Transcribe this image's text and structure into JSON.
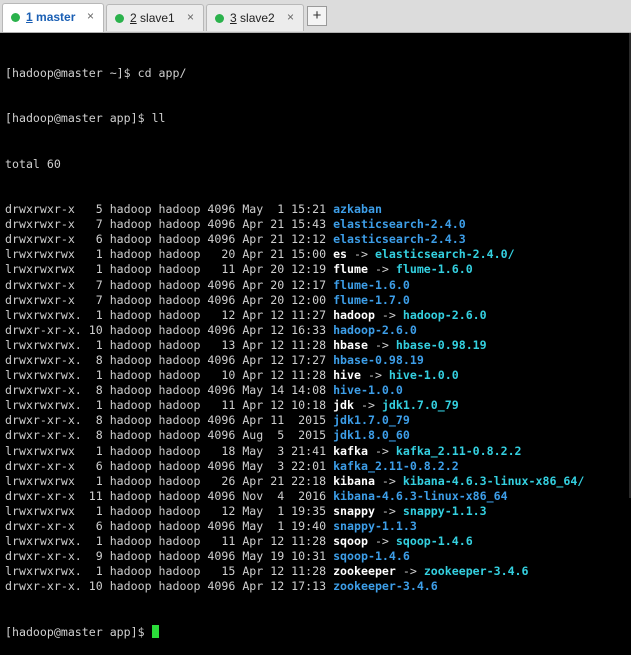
{
  "tabs": [
    {
      "num": "1",
      "name": " master",
      "active": true,
      "close": "×"
    },
    {
      "num": "2",
      "name": " slave1",
      "active": false,
      "close": "×"
    },
    {
      "num": "3",
      "name": " slave2",
      "active": false,
      "close": "×"
    }
  ],
  "add_tab_label": "+",
  "colors": {
    "background": "#000000",
    "text": "#cfcfcf",
    "directory": "#3d9ee8",
    "symlink": "#34d0e0",
    "cursor": "#2bdc3a",
    "tab_status": "#2bb24c"
  },
  "terminal": {
    "commands": [
      "[hadoop@master ~]$ cd app/",
      "[hadoop@master app]$ ll"
    ],
    "total": "total 60",
    "entries": [
      {
        "meta": "drwxrwxr-x   5 hadoop hadoop 4096 May  1 15:21 ",
        "name": "azkaban",
        "type": "dir",
        "target": ""
      },
      {
        "meta": "drwxrwxr-x   7 hadoop hadoop 4096 Apr 21 15:43 ",
        "name": "elasticsearch-2.4.0",
        "type": "dir",
        "target": ""
      },
      {
        "meta": "drwxrwxr-x   6 hadoop hadoop 4096 Apr 21 12:12 ",
        "name": "elasticsearch-2.4.3",
        "type": "dir",
        "target": ""
      },
      {
        "meta": "lrwxrwxrwx   1 hadoop hadoop   20 Apr 21 15:00 ",
        "name": "es",
        "type": "link",
        "target": "elasticsearch-2.4.0/"
      },
      {
        "meta": "lrwxrwxrwx   1 hadoop hadoop   11 Apr 20 12:19 ",
        "name": "flume",
        "type": "link",
        "target": "flume-1.6.0"
      },
      {
        "meta": "drwxrwxr-x   7 hadoop hadoop 4096 Apr 20 12:17 ",
        "name": "flume-1.6.0",
        "type": "dir",
        "target": ""
      },
      {
        "meta": "drwxrwxr-x   7 hadoop hadoop 4096 Apr 20 12:00 ",
        "name": "flume-1.7.0",
        "type": "dir",
        "target": ""
      },
      {
        "meta": "lrwxrwxrwx.  1 hadoop hadoop   12 Apr 12 11:27 ",
        "name": "hadoop",
        "type": "link",
        "target": "hadoop-2.6.0"
      },
      {
        "meta": "drwxr-xr-x. 10 hadoop hadoop 4096 Apr 12 16:33 ",
        "name": "hadoop-2.6.0",
        "type": "dir",
        "target": ""
      },
      {
        "meta": "lrwxrwxrwx.  1 hadoop hadoop   13 Apr 12 11:28 ",
        "name": "hbase",
        "type": "link",
        "target": "hbase-0.98.19"
      },
      {
        "meta": "drwxrwxr-x.  8 hadoop hadoop 4096 Apr 12 17:27 ",
        "name": "hbase-0.98.19",
        "type": "dir",
        "target": ""
      },
      {
        "meta": "lrwxrwxrwx.  1 hadoop hadoop   10 Apr 12 11:28 ",
        "name": "hive",
        "type": "link",
        "target": "hive-1.0.0"
      },
      {
        "meta": "drwxrwxr-x.  8 hadoop hadoop 4096 May 14 14:08 ",
        "name": "hive-1.0.0",
        "type": "dir",
        "target": ""
      },
      {
        "meta": "lrwxrwxrwx.  1 hadoop hadoop   11 Apr 12 10:18 ",
        "name": "jdk",
        "type": "link",
        "target": "jdk1.7.0_79"
      },
      {
        "meta": "drwxr-xr-x.  8 hadoop hadoop 4096 Apr 11  2015 ",
        "name": "jdk1.7.0_79",
        "type": "dir",
        "target": ""
      },
      {
        "meta": "drwxr-xr-x.  8 hadoop hadoop 4096 Aug  5  2015 ",
        "name": "jdk1.8.0_60",
        "type": "dir",
        "target": ""
      },
      {
        "meta": "lrwxrwxrwx   1 hadoop hadoop   18 May  3 21:41 ",
        "name": "kafka",
        "type": "link",
        "target": "kafka_2.11-0.8.2.2"
      },
      {
        "meta": "drwxr-xr-x   6 hadoop hadoop 4096 May  3 22:01 ",
        "name": "kafka_2.11-0.8.2.2",
        "type": "dir",
        "target": ""
      },
      {
        "meta": "lrwxrwxrwx   1 hadoop hadoop   26 Apr 21 22:18 ",
        "name": "kibana",
        "type": "link",
        "target": "kibana-4.6.3-linux-x86_64/"
      },
      {
        "meta": "drwxr-xr-x  11 hadoop hadoop 4096 Nov  4  2016 ",
        "name": "kibana-4.6.3-linux-x86_64",
        "type": "dir",
        "target": ""
      },
      {
        "meta": "lrwxrwxrwx   1 hadoop hadoop   12 May  1 19:35 ",
        "name": "snappy",
        "type": "link",
        "target": "snappy-1.1.3"
      },
      {
        "meta": "drwxr-xr-x   6 hadoop hadoop 4096 May  1 19:40 ",
        "name": "snappy-1.1.3",
        "type": "dir",
        "target": ""
      },
      {
        "meta": "lrwxrwxrwx.  1 hadoop hadoop   11 Apr 12 11:28 ",
        "name": "sqoop",
        "type": "link",
        "target": "sqoop-1.4.6"
      },
      {
        "meta": "drwxr-xr-x.  9 hadoop hadoop 4096 May 19 10:31 ",
        "name": "sqoop-1.4.6",
        "type": "dir",
        "target": ""
      },
      {
        "meta": "lrwxrwxrwx.  1 hadoop hadoop   15 Apr 12 11:28 ",
        "name": "zookeeper",
        "type": "link",
        "target": "zookeeper-3.4.6"
      },
      {
        "meta": "drwxr-xr-x. 10 hadoop hadoop 4096 Apr 12 17:13 ",
        "name": "zookeeper-3.4.6",
        "type": "dir",
        "target": ""
      }
    ],
    "arrow": " -> ",
    "prompt": "[hadoop@master app]$ "
  }
}
